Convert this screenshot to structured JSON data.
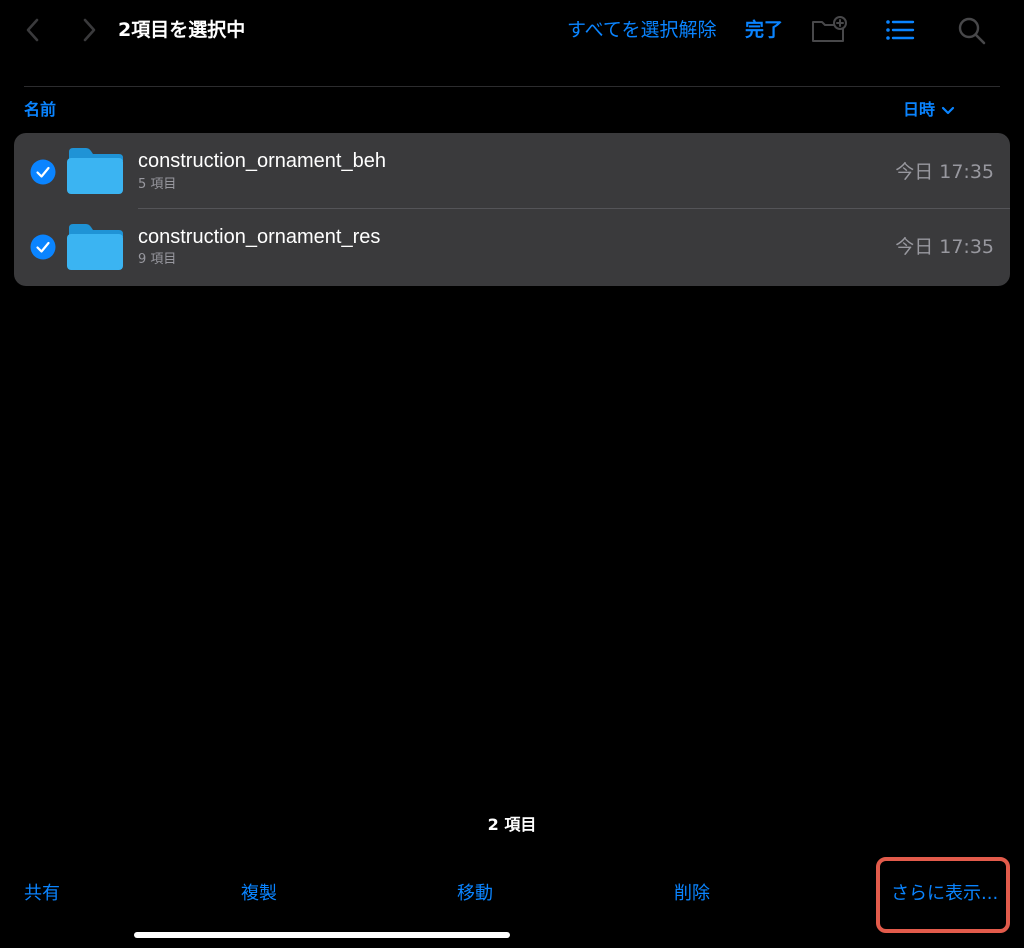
{
  "header": {
    "title": "2項目を選択中",
    "deselect_all_label": "すべてを選択解除",
    "done_label": "完了",
    "back_icon": "chevron-left-icon",
    "forward_icon": "chevron-right-icon",
    "new_folder_icon": "folder-plus-icon",
    "view_icon": "list-icon",
    "search_icon": "search-icon"
  },
  "columns": {
    "name_label": "名前",
    "date_label": "日時",
    "sort_icon": "chevron-down-icon"
  },
  "files": [
    {
      "name": "construction_ornament_beh",
      "meta": "5 項目",
      "date": "今日 17:35",
      "selected": true,
      "icon": "folder-icon"
    },
    {
      "name": "construction_ornament_res",
      "meta": "9 項目",
      "date": "今日 17:35",
      "selected": true,
      "icon": "folder-icon"
    }
  ],
  "footer": {
    "item_count": "2 項目",
    "actions": [
      {
        "label": "共有"
      },
      {
        "label": "複製"
      },
      {
        "label": "移動"
      },
      {
        "label": "削除"
      },
      {
        "label": "さらに表示..."
      }
    ]
  },
  "colors": {
    "accent": "#0a84ff",
    "background": "#000000",
    "card": "#3a3a3c",
    "secondary_text": "#98989f",
    "folder": "#3bb4f2",
    "highlight": "#e25b4b"
  }
}
